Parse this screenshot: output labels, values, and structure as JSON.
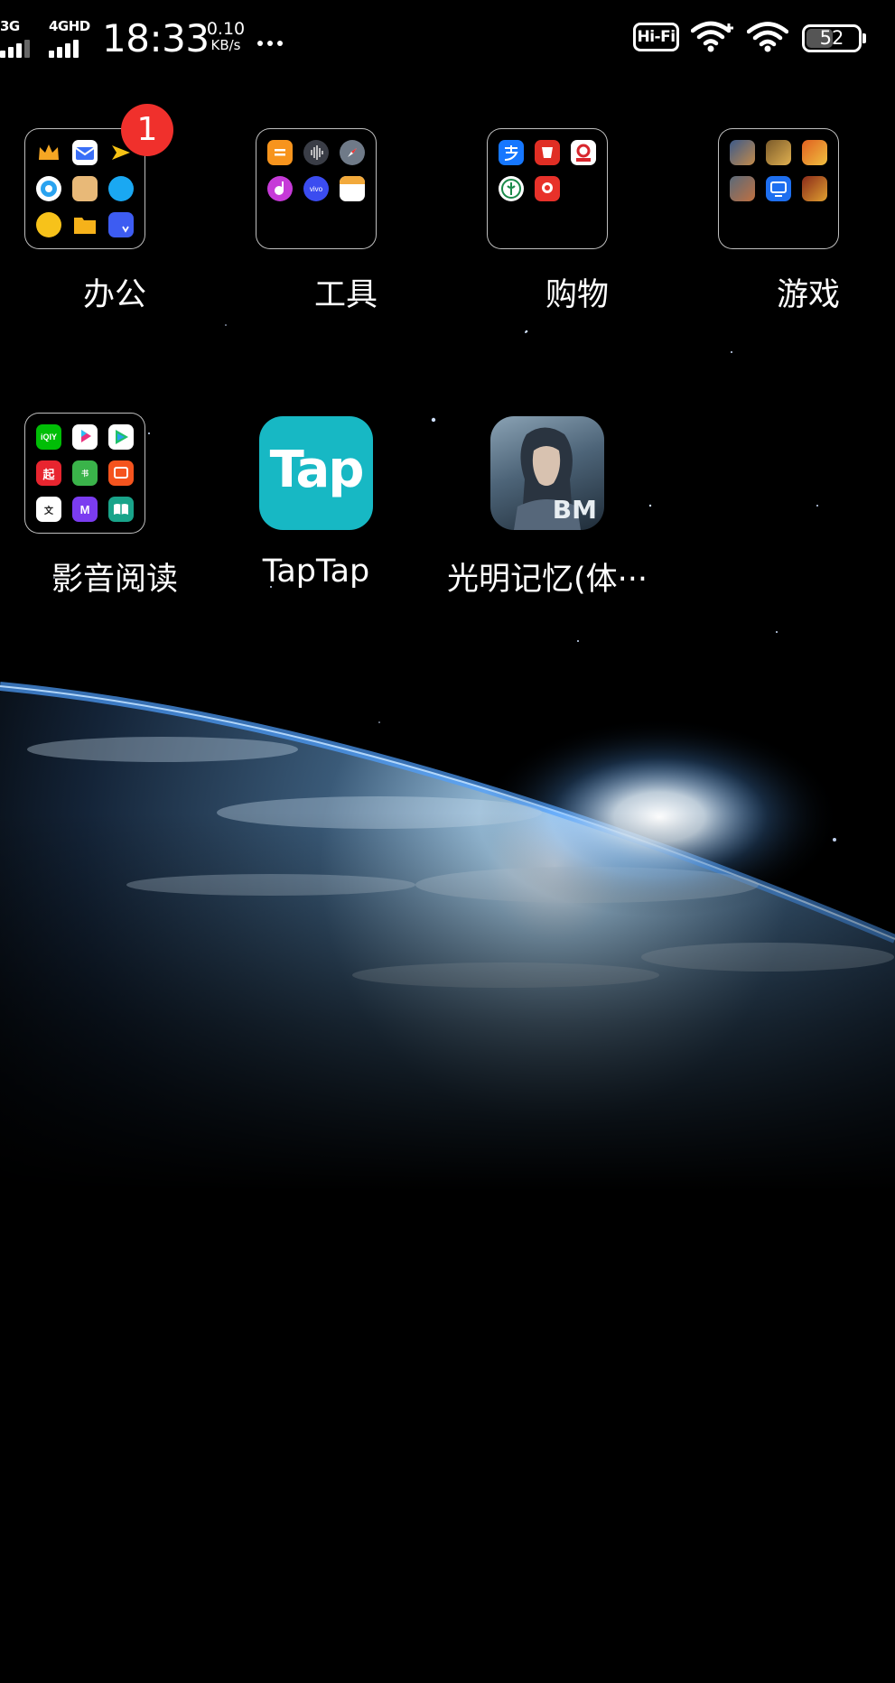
{
  "status_bar": {
    "signal_1": "3G",
    "signal_2": "4GHD",
    "time": "18:33",
    "net_speed_value": "0.10",
    "net_speed_unit": "KB/s",
    "hifi": "Hi-Fi",
    "battery_level": "52"
  },
  "home": {
    "folders": [
      {
        "label": "办公",
        "badge": "1"
      },
      {
        "label": "工具"
      },
      {
        "label": "购物"
      },
      {
        "label": "游戏"
      },
      {
        "label": "影音阅读"
      }
    ],
    "apps": [
      {
        "label": "TapTap",
        "icon_text": "Tap"
      },
      {
        "label": "光明记忆(体···",
        "icon_text": "BM"
      }
    ]
  },
  "colors": {
    "badge": "#f0302c",
    "taptap": "#17b8c4",
    "background": "#000000"
  }
}
